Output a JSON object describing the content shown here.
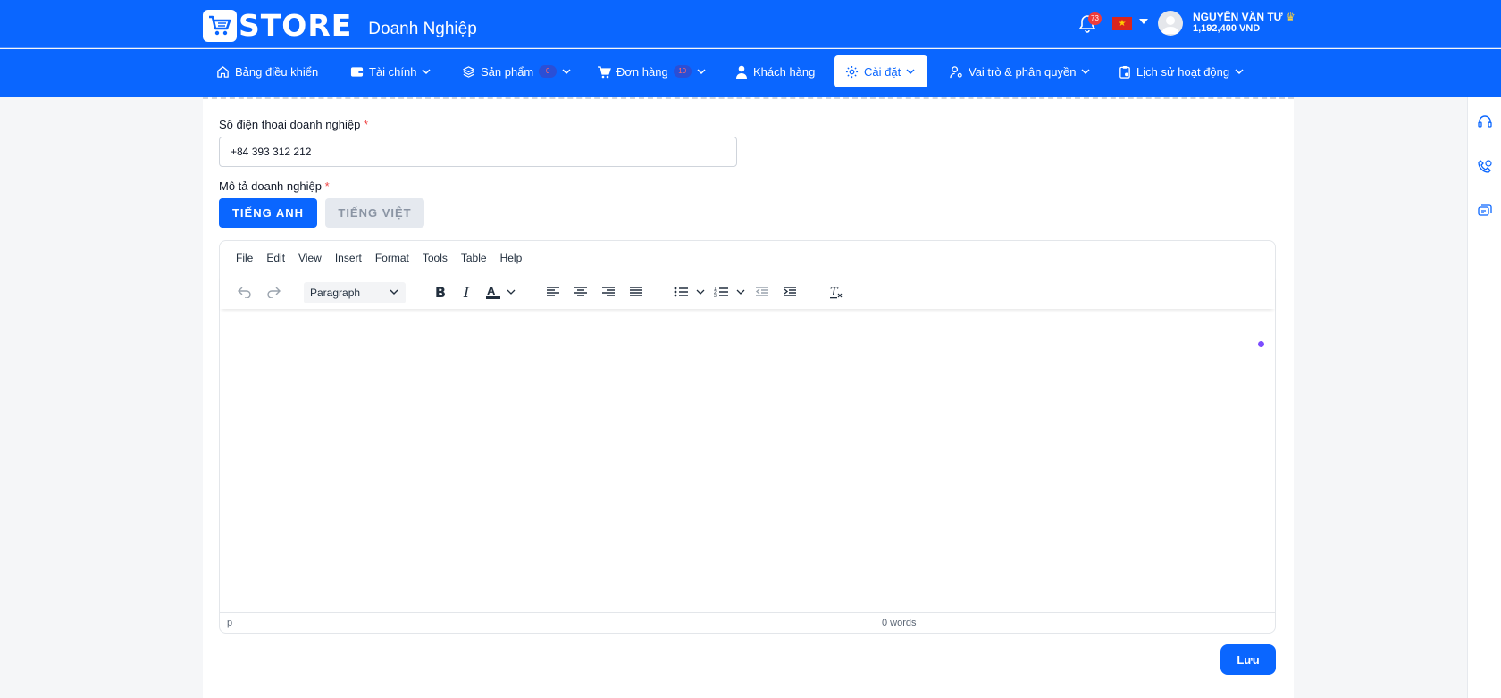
{
  "header": {
    "logo_text": "STORE",
    "subtitle": "Doanh Nghiệp",
    "notifications_count": "73",
    "language_flag_star": "★",
    "user_name": "NGUYỄN VĂN TƯ",
    "balance": "1,192,400 VND"
  },
  "nav": {
    "items": [
      {
        "label": "Bảng điều khiển",
        "icon": "home-icon"
      },
      {
        "label": "Tài chính",
        "icon": "wallet-icon"
      },
      {
        "label": "Sản phẩm",
        "icon": "layers-icon",
        "badge": "0"
      },
      {
        "label": "Đơn hàng",
        "icon": "cart-icon",
        "badge": "10"
      },
      {
        "label": "Khách hàng",
        "icon": "user-icon"
      },
      {
        "label": "Cài đặt",
        "icon": "gear-icon",
        "active": true
      },
      {
        "label": "Vai trò & phân quyền",
        "icon": "user-role-icon"
      },
      {
        "label": "Lịch sử hoạt động",
        "icon": "clipboard-icon"
      }
    ]
  },
  "form": {
    "phone_label": "Số điện thoại doanh nghiệp",
    "phone_value": "+84 393 312 212",
    "required_mark": "*",
    "description_label": "Mô tả doanh nghiệp",
    "tab_english": "TIẾNG ANH",
    "tab_vietnamese": "TIẾNG VIỆT",
    "save_label": "Lưu"
  },
  "editor": {
    "menu": [
      "File",
      "Edit",
      "View",
      "Insert",
      "Format",
      "Tools",
      "Table",
      "Help"
    ],
    "block_format": "Paragraph",
    "status_path": "p",
    "word_count": "0 words"
  },
  "colors": {
    "primary": "#0a66ff",
    "accent_dot": "#7c4dff",
    "badge_red": "#ef3b3b"
  }
}
